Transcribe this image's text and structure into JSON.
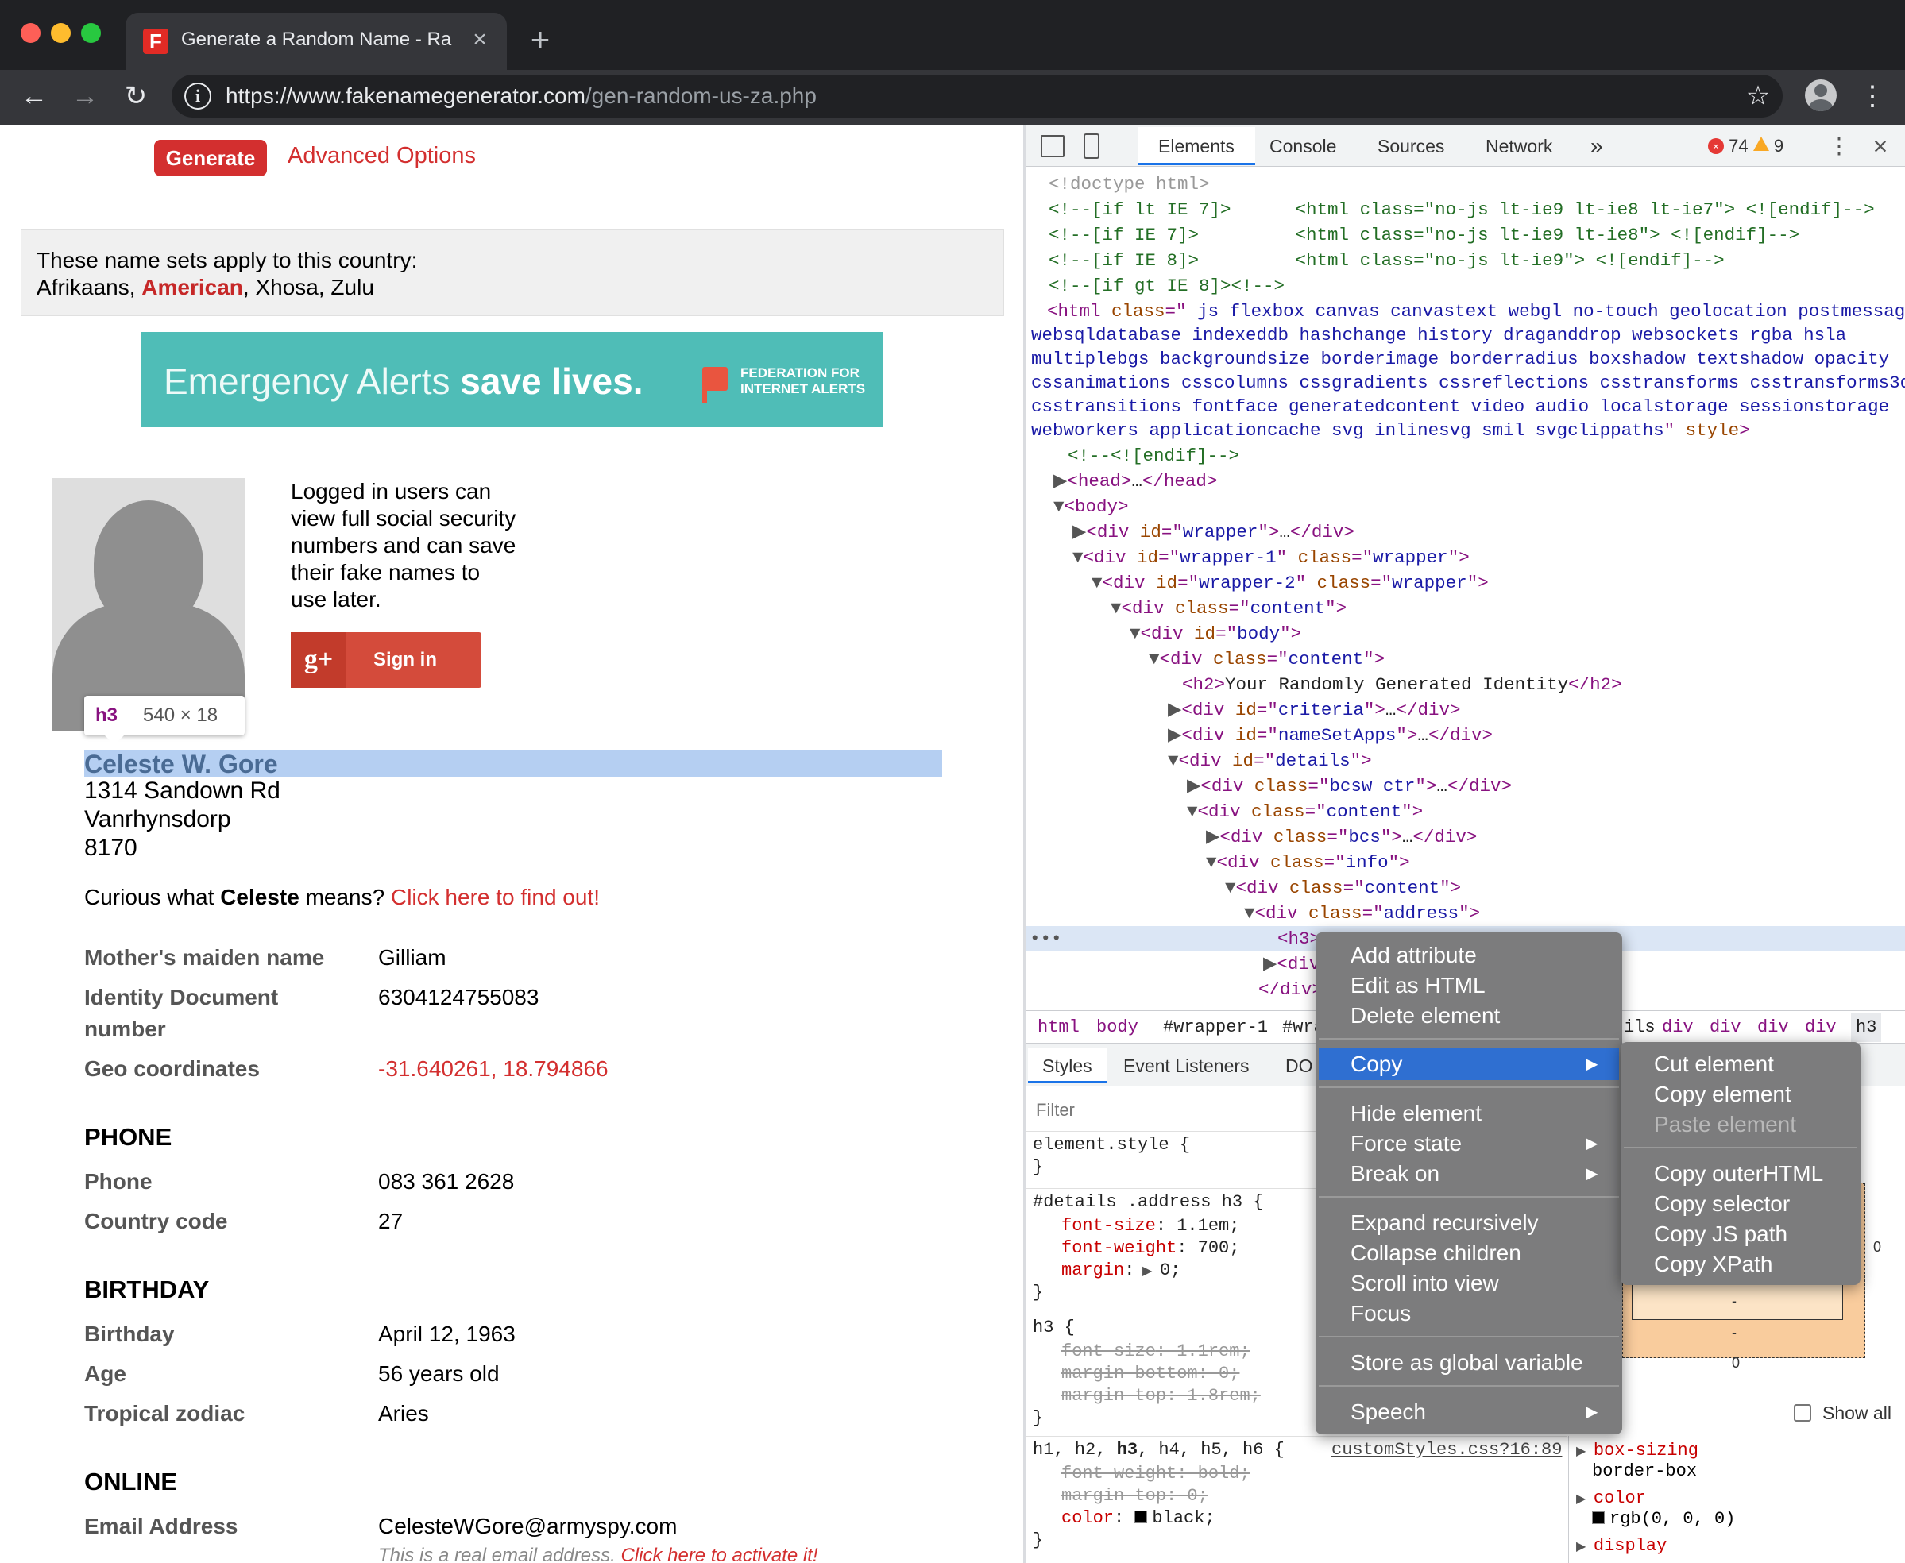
{
  "browser": {
    "tab_title": "Generate a Random Name - Ra",
    "tab_favicon": "F",
    "url_host": "https://www.fakenamegenerator.com",
    "url_path": "/gen-random-us-za.php"
  },
  "page": {
    "generate_label": "Generate",
    "advanced_label": "Advanced Options",
    "nameset_line1": "These name sets apply to this country:",
    "nameset_pre": "Afrikaans, ",
    "nameset_hl": "American",
    "nameset_post": ", Xhosa, Zulu",
    "banner_text": "Emergency Alerts ",
    "banner_bold": "save lives.",
    "banner_org": "FEDERATION FOR INTERNET ALERTS",
    "logged_text": "Logged in users can view full social security numbers and can save their fake names to use later.",
    "signin_label": "Sign in",
    "gplus_glyph": "g+",
    "tooltip_tag": "h3",
    "tooltip_size": "540 × 18",
    "name": "Celeste W. Gore",
    "address": [
      "1314 Sandown Rd",
      "Vanrhynsdorp",
      "8170"
    ],
    "curious_pre": "Curious what ",
    "curious_name": "Celeste",
    "curious_mid": " means? ",
    "curious_link": "Click here to find out!",
    "details": [
      {
        "label": "Mother's maiden name",
        "value": "Gilliam"
      },
      {
        "label": "Identity Document number",
        "value": "6304124755083"
      },
      {
        "label": "Geo coordinates",
        "value": "-31.640261, 18.794866"
      }
    ],
    "phone_section": "PHONE",
    "phone": [
      {
        "label": "Phone",
        "value": "083 361 2628"
      },
      {
        "label": "Country code",
        "value": "27"
      }
    ],
    "birthday_section": "BIRTHDAY",
    "birthday": [
      {
        "label": "Birthday",
        "value": "April 12, 1963"
      },
      {
        "label": "Age",
        "value": "56 years old"
      },
      {
        "label": "Tropical zodiac",
        "value": "Aries"
      }
    ],
    "online_section": "ONLINE",
    "email_label": "Email Address",
    "email_value": "CelesteWGore@armyspy.com",
    "email_note": "This is a real email address. ",
    "email_note_link": "Click here to activate it!"
  },
  "devtools": {
    "tabs": [
      "Elements",
      "Console",
      "Sources",
      "Network",
      "»"
    ],
    "error_count": "74",
    "warning_count": "9",
    "breadcrumbs": [
      "html",
      "body",
      "#wrapper-1",
      "#wra",
      "ils",
      "div",
      "div",
      "div",
      "div",
      "h3"
    ],
    "styles_tabs": [
      "Styles",
      "Event Listeners",
      "DO"
    ],
    "filter_placeholder": "Filter",
    "rule_link": "customStyles.css?16:89",
    "show_all": "Show all",
    "box_zero": "0",
    "box_dash": "-",
    "computed": [
      {
        "prop": "box-sizing",
        "value": "border-box"
      },
      {
        "prop": "color",
        "value": "rgb(0, 0, 0)"
      },
      {
        "prop": "display",
        "value": ""
      }
    ]
  },
  "context_menu": {
    "items": [
      "Add attribute",
      "Edit as HTML",
      "Delete element",
      "Copy",
      "Hide element",
      "Force state",
      "Break on",
      "Expand recursively",
      "Collapse children",
      "Scroll into view",
      "Focus",
      "Store as global variable",
      "Speech"
    ],
    "submenu": [
      "Cut element",
      "Copy element",
      "Paste element",
      "Copy outerHTML",
      "Copy selector",
      "Copy JS path",
      "Copy XPath"
    ]
  },
  "colors": {
    "accent_red": "#d32f2f",
    "devtools_blue": "#1a73e8",
    "menu_bg": "#7c7c7d",
    "menu_highlight": "#2f6fd1"
  },
  "icons": [
    "close-icon",
    "plus-icon",
    "back-icon",
    "forward-icon",
    "reload-icon",
    "info-icon",
    "star-icon",
    "avatar-icon",
    "menu-icon",
    "inspect-icon",
    "device-icon",
    "error-icon",
    "warning-icon",
    "chevron-right-icon"
  ]
}
